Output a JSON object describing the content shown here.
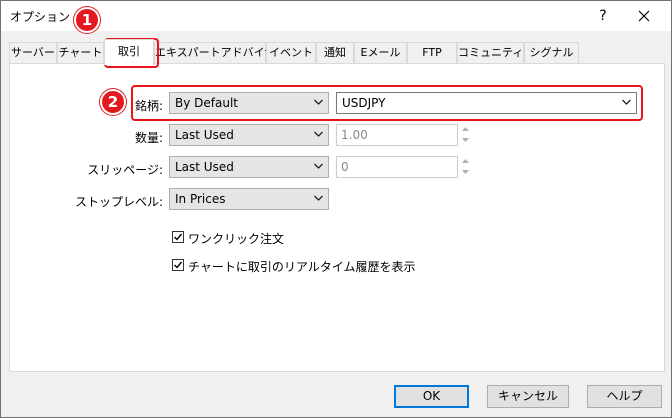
{
  "window": {
    "title": "オプション",
    "help_glyph": "?"
  },
  "tabs": [
    {
      "label": "サーバー"
    },
    {
      "label": "チャート"
    },
    {
      "label": "取引"
    },
    {
      "label": "エキスパートアドバイザ"
    },
    {
      "label": "イベント"
    },
    {
      "label": "通知"
    },
    {
      "label": "Eメール"
    },
    {
      "label": "FTP"
    },
    {
      "label": "コミュニティー"
    },
    {
      "label": "シグナル"
    }
  ],
  "active_tab": "取引",
  "form": {
    "symbol": {
      "label": "銘柄:",
      "mode_value": "By Default",
      "symbol_value": "USDJPY"
    },
    "volume": {
      "label": "数量:",
      "mode_value": "Last Used",
      "spin_value": "1.00"
    },
    "slippage": {
      "label": "スリッページ:",
      "mode_value": "Last Used",
      "spin_value": "0"
    },
    "stop_level": {
      "label": "ストップレベル:",
      "mode_value": "In Prices"
    },
    "one_click": {
      "label": "ワンクリック注文",
      "checked": true
    },
    "show_history": {
      "label": "チャートに取引のリアルタイム履歴を表示",
      "checked": true
    }
  },
  "buttons": {
    "ok": "OK",
    "cancel": "キャンセル",
    "help": "ヘルプ"
  },
  "annotations": {
    "badge1": "1",
    "badge2": "2",
    "color": "#e3191f"
  },
  "icons": [
    "close-icon",
    "chevron-down-icon",
    "spin-up-icon",
    "spin-down-icon",
    "checkmark-icon"
  ]
}
